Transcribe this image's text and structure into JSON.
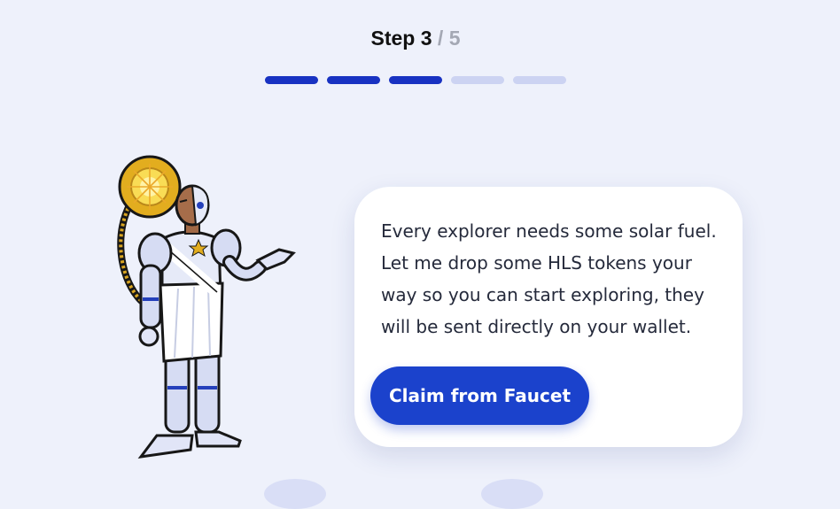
{
  "step": {
    "word": "Step",
    "current": "3",
    "separator": "/",
    "total": "5"
  },
  "progress": {
    "completed": 3,
    "total": 5
  },
  "colors": {
    "accent": "#1b42cc",
    "progress_done": "#1832c2",
    "progress_todo": "#ccd3f2",
    "background": "#eef1fb"
  },
  "card": {
    "message": "Every explorer needs some solar fuel. Let me drop some HLS tokens your way so you can start exploring, they will be sent directly on your wallet.",
    "button_label": "Claim from Faucet"
  },
  "illustration": {
    "icon": "robot-explorer-icon"
  }
}
